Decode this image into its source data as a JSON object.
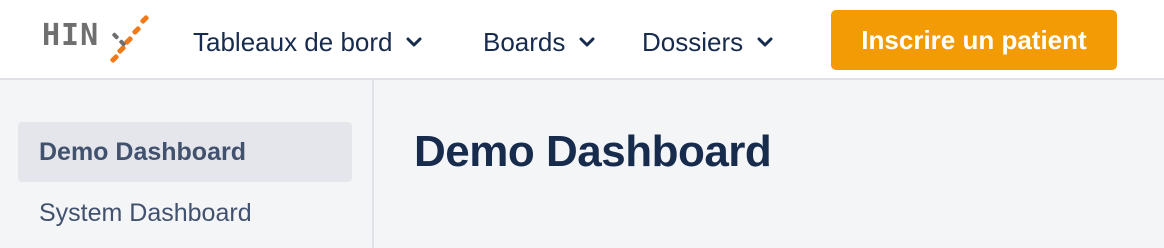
{
  "header": {
    "logo": {
      "text": "HIN",
      "accent_color": "#f07a1a"
    },
    "nav": [
      {
        "label": "Tableaux de bord",
        "icon": "chevron-down-icon"
      },
      {
        "label": "Boards",
        "icon": "chevron-down-icon"
      },
      {
        "label": "Dossiers",
        "icon": "chevron-down-icon"
      }
    ],
    "cta": {
      "label": "Inscrire un patient",
      "color": "#f29b05"
    }
  },
  "sidebar": {
    "items": [
      {
        "label": "Demo Dashboard",
        "active": true
      },
      {
        "label": "System Dashboard",
        "active": false
      }
    ]
  },
  "main": {
    "title": "Demo Dashboard"
  },
  "colors": {
    "text_primary": "#172b4d",
    "text_secondary": "#42526e",
    "background": "#f4f5f7",
    "divider": "#dfe1e6"
  }
}
